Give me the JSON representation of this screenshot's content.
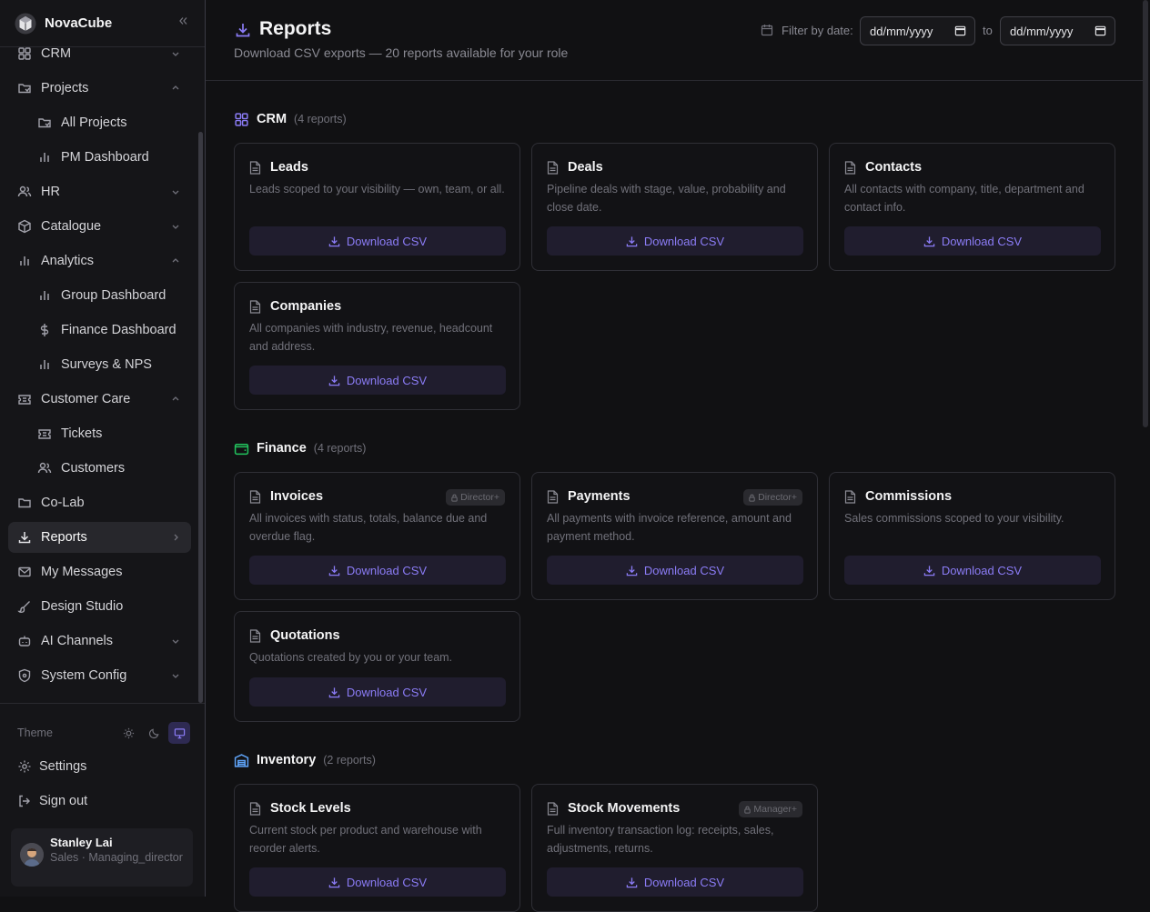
{
  "app": {
    "name": "NovaCube"
  },
  "sidebar": {
    "items": [
      {
        "label": "CRM"
      },
      {
        "label": "Projects"
      },
      {
        "label": "All Projects"
      },
      {
        "label": "PM Dashboard"
      },
      {
        "label": "HR"
      },
      {
        "label": "Catalogue"
      },
      {
        "label": "Analytics"
      },
      {
        "label": "Group Dashboard"
      },
      {
        "label": "Finance Dashboard"
      },
      {
        "label": "Surveys & NPS"
      },
      {
        "label": "Customer Care"
      },
      {
        "label": "Tickets"
      },
      {
        "label": "Customers"
      },
      {
        "label": "Co-Lab"
      },
      {
        "label": "Reports"
      },
      {
        "label": "My Messages"
      },
      {
        "label": "Design Studio"
      },
      {
        "label": "AI Channels"
      },
      {
        "label": "System Config"
      }
    ],
    "theme_label": "Theme",
    "settings_label": "Settings",
    "signout_label": "Sign out",
    "user": {
      "name": "Stanley Lai",
      "role": "Sales · Managing_director"
    }
  },
  "header": {
    "title": "Reports",
    "subtitle": "Download CSV exports — 20 reports available for your role",
    "filter_label": "Filter by date:",
    "date_from": "dd/mm/yyyy",
    "to_label": "to",
    "date_to": "dd/mm/yyyy"
  },
  "download_label": "Download CSV",
  "sections": [
    {
      "name": "CRM",
      "count": "(4 reports)",
      "color": "#8b7cf6",
      "icon": "grid-icon"
    },
    {
      "name": "Finance",
      "count": "(4 reports)",
      "color": "#22c55e",
      "icon": "wallet-icon"
    },
    {
      "name": "Inventory",
      "count": "(2 reports)",
      "color": "#60a5fa",
      "icon": "warehouse-icon"
    }
  ],
  "reports": [
    {
      "title": "Leads",
      "desc": "Leads scoped to your visibility — own, team, or all.",
      "badge": ""
    },
    {
      "title": "Deals",
      "desc": "Pipeline deals with stage, value, probability and close date.",
      "badge": ""
    },
    {
      "title": "Contacts",
      "desc": "All contacts with company, title, department and contact info.",
      "badge": ""
    },
    {
      "title": "Companies",
      "desc": "All companies with industry, revenue, headcount and address.",
      "badge": ""
    },
    {
      "title": "Invoices",
      "desc": "All invoices with status, totals, balance due and overdue flag.",
      "badge": "Director+"
    },
    {
      "title": "Payments",
      "desc": "All payments with invoice reference, amount and payment method.",
      "badge": "Director+"
    },
    {
      "title": "Commissions",
      "desc": "Sales commissions scoped to your visibility.",
      "badge": ""
    },
    {
      "title": "Quotations",
      "desc": "Quotations created by you or your team.",
      "badge": ""
    },
    {
      "title": "Stock Levels",
      "desc": "Current stock per product and warehouse with reorder alerts.",
      "badge": ""
    },
    {
      "title": "Stock Movements",
      "desc": "Full inventory transaction log: receipts, sales, adjustments, returns.",
      "badge": "Manager+"
    }
  ]
}
